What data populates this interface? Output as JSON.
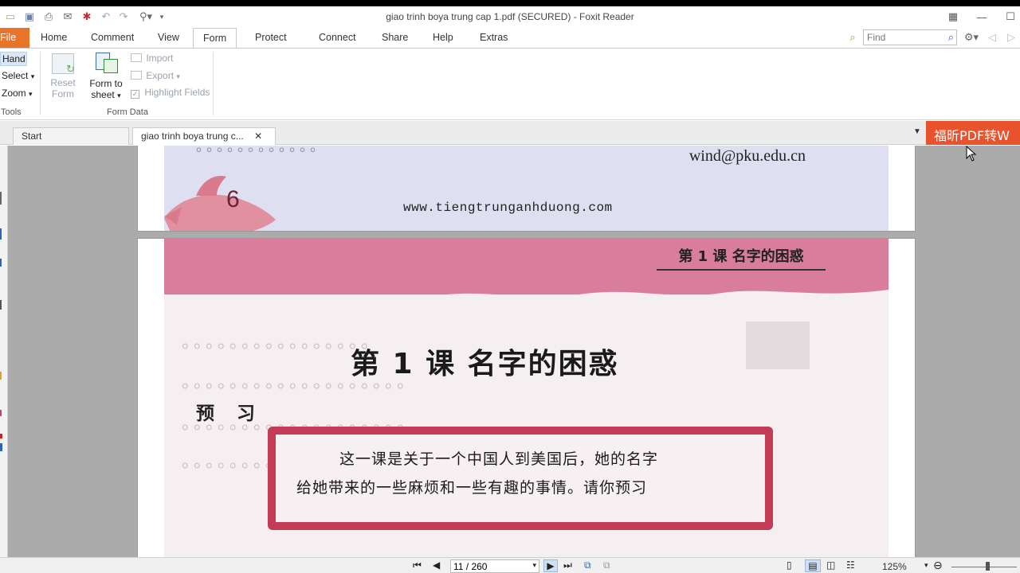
{
  "window": {
    "title": "giao trinh boya trung cap 1.pdf (SECURED) - Foxit Reader"
  },
  "menus": {
    "file": "File",
    "home": "Home",
    "comment": "Comment",
    "view": "View",
    "form": "Form",
    "protect": "Protect",
    "connect": "Connect",
    "share": "Share",
    "help": "Help",
    "extras": "Extras",
    "active": "Form"
  },
  "find": {
    "placeholder": "Find"
  },
  "ribbon": {
    "tools": {
      "hand": "Hand",
      "select": "Select",
      "zoom": "Zoom",
      "group_label": "Tools"
    },
    "form_data": {
      "reset_form_line1": "Reset",
      "reset_form_line2": "Form",
      "form_to_sheet_line1": "Form to",
      "form_to_sheet_line2": "sheet",
      "import": "Import",
      "export": "Export",
      "highlight_fields": "Highlight Fields",
      "group_label": "Form Data"
    }
  },
  "tabs": {
    "start": "Start",
    "document": "giao trinh boya trung c..."
  },
  "ad_banner": "福昕PDF转W",
  "page_prev": {
    "email": "wind@pku.edu.cn",
    "url": "www.tiengtrunganhduong.com",
    "page_number": "6"
  },
  "page_current": {
    "header": "第 1 课   名字的困惑",
    "title": "第 1 课   名字的困惑",
    "section": "预 习",
    "box_line1": "这一课是关于一个中国人到美国后，她的名字",
    "box_line2": "给她带来的一些麻烦和一些有趣的事情。请你预习"
  },
  "statusbar": {
    "page_indicator": "11 / 260",
    "zoom": "125%"
  },
  "colors": {
    "file_menu": "#e8742a",
    "ad_banner": "#e8532d",
    "page_pink": "#d87e9c",
    "red_box": "#c43b55"
  }
}
